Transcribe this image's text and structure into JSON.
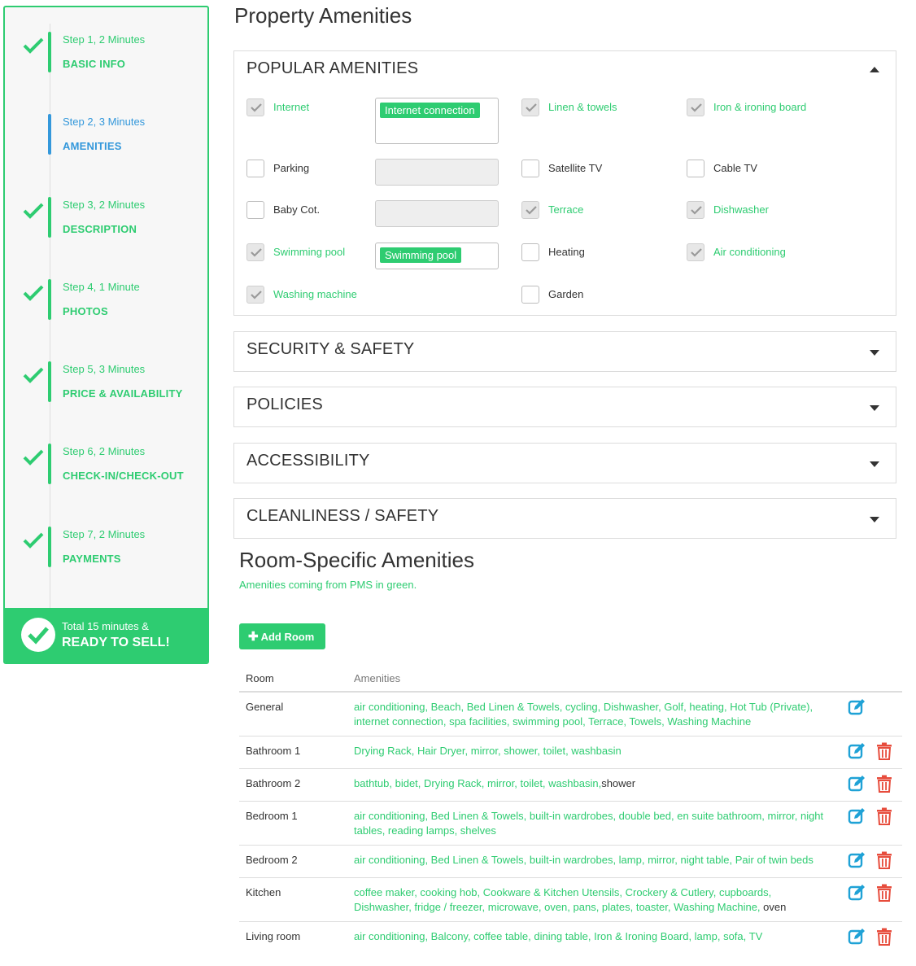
{
  "sidebar": {
    "steps": [
      {
        "sub": "Step 1, 2 Minutes",
        "title": "BASIC INFO",
        "done": true
      },
      {
        "sub": "Step 2, 3 Minutes",
        "title": "AMENITIES",
        "done": false
      },
      {
        "sub": "Step 3, 2 Minutes",
        "title": "DESCRIPTION",
        "done": true
      },
      {
        "sub": "Step 4, 1 Minute",
        "title": "PHOTOS",
        "done": true
      },
      {
        "sub": "Step 5, 3 Minutes",
        "title": "PRICE & AVAILABILITY",
        "done": true
      },
      {
        "sub": "Step 6, 2 Minutes",
        "title": "CHECK-IN/CHECK-OUT",
        "done": true
      },
      {
        "sub": "Step 7, 2 Minutes",
        "title": "PAYMENTS",
        "done": true
      }
    ],
    "total_line": "Total 15 minutes &",
    "ready_line": "READY TO SELL!"
  },
  "page_title": "Property Amenities",
  "sections": {
    "popular": "POPULAR AMENITIES",
    "security": "SECURITY & SAFETY",
    "policies": "POLICIES",
    "accessibility": "ACCESSIBILITY",
    "cleanliness": "CLEANLINESS / SAFETY"
  },
  "amenities": {
    "internet": "Internet",
    "internet_tag": "Internet connection",
    "linen": "Linen & towels",
    "iron": "Iron & ironing board",
    "parking": "Parking",
    "satellite": "Satellite TV",
    "cable": "Cable TV",
    "babycot": "Baby Cot.",
    "terrace": "Terrace",
    "dishwasher": "Dishwasher",
    "pool": "Swimming pool",
    "pool_tag": "Swimming pool",
    "heating": "Heating",
    "aircon": "Air conditioning",
    "washing": "Washing machine",
    "garden": "Garden"
  },
  "room_specific": {
    "title": "Room-Specific Amenities",
    "note": "Amenities coming from PMS in green.",
    "add_room": "Add Room",
    "col_room": "Room",
    "col_amenities": "Amenities",
    "rows": [
      {
        "room": "General",
        "pms": "air conditioning, Beach, Bed Linen & Towels, cycling, Dishwasher, Golf, heating, Hot Tub (Private), internet connection, spa facilities, swimming pool, Terrace, Towels, Washing Machine",
        "local": ""
      },
      {
        "room": "Bathroom 1",
        "pms": "Drying Rack, Hair Dryer, mirror, shower, toilet, washbasin",
        "local": ""
      },
      {
        "room": "Bathroom 2",
        "pms": "bathtub, bidet, Drying Rack, mirror, toilet, washbasin,",
        "local": "shower"
      },
      {
        "room": "Bedroom 1",
        "pms": "air conditioning, Bed Linen & Towels, built-in wardrobes, double bed, en suite bathroom, mirror, night tables, reading lamps, shelves",
        "local": ""
      },
      {
        "room": "Bedroom 2",
        "pms": "air conditioning, Bed Linen & Towels, built-in wardrobes, lamp, mirror, night table, Pair of twin beds",
        "local": ""
      },
      {
        "room": "Kitchen",
        "pms": "coffee maker, cooking hob, Cookware & Kitchen Utensils, Crockery & Cutlery, cupboards, Dishwasher, fridge / freezer, microwave, oven, pans, plates, toaster, Washing Machine,",
        "local": "oven"
      },
      {
        "room": "Living room",
        "pms": "air conditioning, Balcony, coffee table, dining table, Iron & Ironing Board, lamp, sofa, TV",
        "local": ""
      }
    ]
  },
  "colors": {
    "green": "#2ecc71",
    "blue": "#3498db",
    "edit": "#1fa2d6",
    "delete": "#e74c3c"
  }
}
